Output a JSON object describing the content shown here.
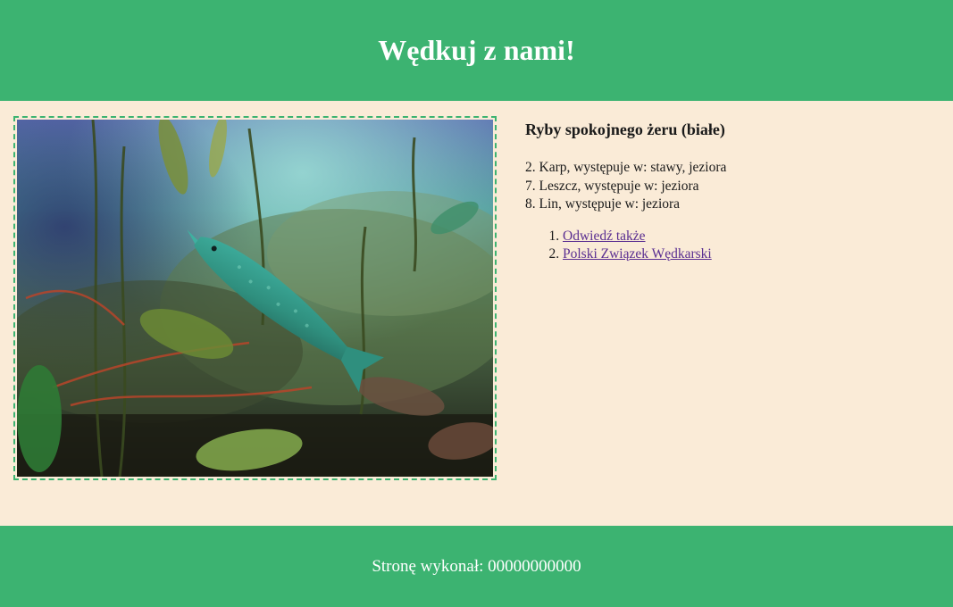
{
  "header": {
    "title": "Wędkuj z nami!"
  },
  "photo": {
    "subject": "underwater photo of a pike among aquatic plants"
  },
  "fish_section": {
    "heading": "Ryby spokojnego żeru (białe)",
    "fish": [
      {
        "text": "2. Karp, występuje w: stawy, jeziora"
      },
      {
        "text": "7. Leszcz, występuje w: jeziora"
      },
      {
        "text": "8. Lin, występuje w: jeziora"
      }
    ],
    "links": [
      {
        "label": "Odwiedź także"
      },
      {
        "label": "Polski Związek Wędkarski"
      }
    ]
  },
  "footer": {
    "text": "Stronę wykonał: 00000000000"
  },
  "colors": {
    "primary_green": "#3cb371",
    "background": "#faebd7",
    "link": "#5a2e91"
  }
}
